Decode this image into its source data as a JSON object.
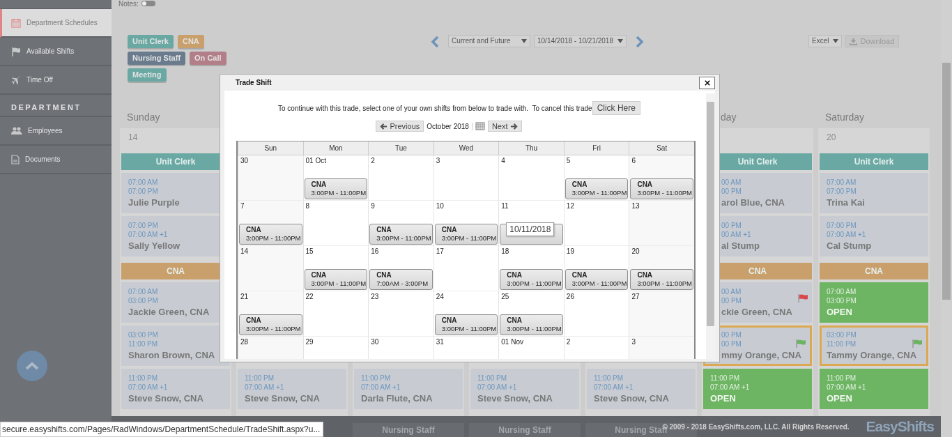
{
  "sidebar": {
    "items": [
      {
        "kind": "link",
        "label": "Department Schedules",
        "selected": true
      },
      {
        "kind": "link",
        "label": "Available Shifts",
        "selected": false
      },
      {
        "kind": "link",
        "label": "Time Off",
        "selected": false
      },
      {
        "kind": "heading",
        "label": "DEPARTMENT"
      },
      {
        "kind": "link",
        "label": "Employees",
        "selected": false
      },
      {
        "kind": "link",
        "label": "Documents",
        "selected": false
      }
    ]
  },
  "notes": {
    "label": "Notes:",
    "on": false
  },
  "tags": [
    {
      "label": "Unit Clerk",
      "color": "#6aa9a3"
    },
    {
      "label": "CNA",
      "color": "#c9a06c"
    },
    {
      "label": "Nursing Staff",
      "color": "#6a7b8e"
    },
    {
      "label": "On Call",
      "color": "#b27f89"
    },
    {
      "label": "Meeting",
      "color": "#6aa9a3"
    }
  ],
  "range_select": {
    "value": "Current and Future"
  },
  "week_select": {
    "value": "10/14/2018 - 10/21/2018"
  },
  "export": {
    "format": "Excel",
    "download": "Download"
  },
  "columns": [
    {
      "day_name": "Sunday",
      "date": "14",
      "items": [
        {
          "kind": "heading",
          "label": "Unit Clerk",
          "color": "#6aa9a3"
        },
        {
          "kind": "shift",
          "start": "07:00 AM",
          "end": "07:00 PM",
          "name": "Julie Purple",
          "highlighted": false
        },
        {
          "kind": "shift",
          "start": "07:00 PM",
          "end": "07:00 AM +1",
          "name": "Sally Yellow",
          "highlighted": false
        },
        {
          "kind": "heading",
          "label": "CNA",
          "color": "#c9a06c"
        },
        {
          "kind": "shift",
          "start": "07:00 AM",
          "end": "03:00 PM",
          "name": "Jackie Green, CNA",
          "highlighted": false
        },
        {
          "kind": "shift",
          "start": "03:00 PM",
          "end": "11:00 PM",
          "name": "Sharon Brown, CNA",
          "highlighted": false
        },
        {
          "kind": "shift",
          "start": "11:00 PM",
          "end": "07:00 AM +1",
          "name": "Steve Snow, CNA",
          "highlighted": false
        }
      ]
    },
    {
      "items": [
        {
          "kind": "shift",
          "start": "11:00 PM",
          "end": "07:00 AM +1",
          "name": "Steve Snow, CNA",
          "highlighted": false
        }
      ]
    },
    {
      "bottom_heading": "Nursing Staff",
      "items": [
        {
          "kind": "shift",
          "start": "11:00 PM",
          "end": "07:00 AM +1",
          "name": "Darla Flute, CNA",
          "highlighted": false
        }
      ]
    },
    {
      "bottom_heading": "Nursing Staff",
      "items": [
        {
          "kind": "shift",
          "start": "11:00 PM",
          "end": "07:00 AM +1",
          "name": "Steve Snow, CNA",
          "highlighted": false
        }
      ]
    },
    {
      "bottom_heading": "Nursing Staff",
      "items": [
        {
          "kind": "shift",
          "start": "11:00 PM",
          "end": "07:00 AM +1",
          "name": "Steve Snow, CNA",
          "highlighted": false
        }
      ]
    },
    {
      "day_name": "day",
      "partly_hidden": true,
      "items": [
        {
          "kind": "heading",
          "label": "Unit Clerk",
          "color": "#6aa9a3"
        },
        {
          "kind": "shift",
          "start": "00 AM",
          "end": "00 PM",
          "name": "arol Blue, CNA",
          "highlighted": false
        },
        {
          "kind": "shift",
          "start": "00 PM",
          "end": "00 AM +1",
          "name": "al Stump",
          "highlighted": false
        },
        {
          "kind": "heading",
          "label": "CNA",
          "color": "#c9a06c"
        },
        {
          "kind": "shift",
          "start": "00 AM",
          "end": "00 PM",
          "name": "ckie Green, CNA",
          "highlighted": false,
          "flag": {
            "color": "#d9474a"
          }
        },
        {
          "kind": "shift",
          "start": "00 PM",
          "end": "00 PM",
          "name": "mmy Orange, CNA",
          "highlighted": true,
          "flag": {
            "color": "#6cb462"
          }
        },
        {
          "kind": "open",
          "start": "11:00 PM",
          "end": "07:00 AM +1",
          "name": "OPEN",
          "highlighted": false
        }
      ]
    },
    {
      "day_name": "Saturday",
      "date": "20",
      "items": [
        {
          "kind": "heading",
          "label": "Unit Clerk",
          "color": "#6aa9a3"
        },
        {
          "kind": "shift",
          "start": "07:00 AM",
          "end": "07:00 PM",
          "name": "Trina Kai",
          "highlighted": false
        },
        {
          "kind": "shift",
          "start": "07:00 PM",
          "end": "07:00 AM +1",
          "name": "Cal Stump",
          "highlighted": false
        },
        {
          "kind": "heading",
          "label": "CNA",
          "color": "#c9a06c"
        },
        {
          "kind": "open",
          "start": "07:00 AM",
          "end": "03:00 PM",
          "name": "OPEN",
          "highlighted": false
        },
        {
          "kind": "shift",
          "start": "03:00 PM",
          "end": "11:00 PM",
          "name": "Tammy Orange, CNA",
          "highlighted": true,
          "flag": {
            "color": "#6cb462"
          }
        },
        {
          "kind": "open",
          "start": "11:00 PM",
          "end": "07:00 AM +1",
          "name": "OPEN",
          "highlighted": false
        }
      ]
    }
  ],
  "footer": {
    "copyright": "© 2009 - 2018 EasyShifts.com, LLC. All Rights Reserved.",
    "logo": "EasyShifts"
  },
  "status_url": "secure.easyshifts.com/Pages/RadWindows/DepartmentSchedule/TradeShift.aspx?u...",
  "dialog": {
    "title": "Trade Shift",
    "message": "To continue with this trade, select one of your own shifts from below to trade with.  To cancel this trade",
    "cancel_button": "Click Here",
    "previous": "Previous",
    "month": "October 2018",
    "next": "Next",
    "weekdays": [
      "Sun",
      "Mon",
      "Tue",
      "Wed",
      "Thu",
      "Fri",
      "Sat"
    ],
    "weeks": [
      [
        {
          "date": "30"
        },
        {
          "date": "01 Oct",
          "shift": {
            "kind": "shift",
            "label": "CNA",
            "time": "3:00PM - 11:00PM"
          }
        },
        {
          "date": "2"
        },
        {
          "date": "3"
        },
        {
          "date": "4"
        },
        {
          "date": "5",
          "shift": {
            "kind": "shift",
            "label": "CNA",
            "time": "3:00PM - 11:00PM"
          }
        },
        {
          "date": "6",
          "shift": {
            "kind": "shift",
            "label": "CNA",
            "time": "3:00PM - 11:00PM"
          }
        }
      ],
      [
        {
          "date": "7",
          "shift": {
            "kind": "shift",
            "label": "CNA",
            "time": "3:00PM - 11:00PM"
          }
        },
        {
          "date": "8"
        },
        {
          "date": "9",
          "shift": {
            "kind": "shift",
            "label": "CNA",
            "time": "3:00PM - 11:00PM"
          }
        },
        {
          "date": "10",
          "shift": {
            "kind": "shift",
            "label": "CNA",
            "time": "3:00PM - 11:00PM"
          }
        },
        {
          "date": "11",
          "shift": {
            "kind": "covered"
          },
          "tooltip": "10/11/2018"
        },
        {
          "date": "12"
        },
        {
          "date": "13"
        }
      ],
      [
        {
          "date": "14"
        },
        {
          "date": "15",
          "shift": {
            "kind": "shift",
            "label": "CNA",
            "time": "3:00PM - 11:00PM"
          }
        },
        {
          "date": "16",
          "shift": {
            "kind": "shift",
            "label": "CNA",
            "time": "7:00AM - 3:00PM"
          }
        },
        {
          "date": "17"
        },
        {
          "date": "18",
          "shift": {
            "kind": "shift",
            "label": "CNA",
            "time": "3:00PM - 11:00PM"
          }
        },
        {
          "date": "19",
          "shift": {
            "kind": "shift",
            "label": "CNA",
            "time": "3:00PM - 11:00PM"
          }
        },
        {
          "date": "20",
          "shift": {
            "kind": "shift",
            "label": "CNA",
            "time": "3:00PM - 11:00PM"
          }
        }
      ],
      [
        {
          "date": "21",
          "shift": {
            "kind": "shift",
            "label": "CNA",
            "time": "3:00PM - 11:00PM"
          }
        },
        {
          "date": "22"
        },
        {
          "date": "23"
        },
        {
          "date": "24",
          "shift": {
            "kind": "shift",
            "label": "CNA",
            "time": "3:00PM - 11:00PM"
          }
        },
        {
          "date": "25",
          "shift": {
            "kind": "shift",
            "label": "CNA",
            "time": "3:00PM - 11:00PM"
          }
        },
        {
          "date": "26"
        },
        {
          "date": "27"
        }
      ],
      [
        {
          "date": "28"
        },
        {
          "date": "29"
        },
        {
          "date": "30"
        },
        {
          "date": "31"
        },
        {
          "date": "01 Nov"
        },
        {
          "date": "2"
        },
        {
          "date": "3"
        }
      ]
    ]
  }
}
